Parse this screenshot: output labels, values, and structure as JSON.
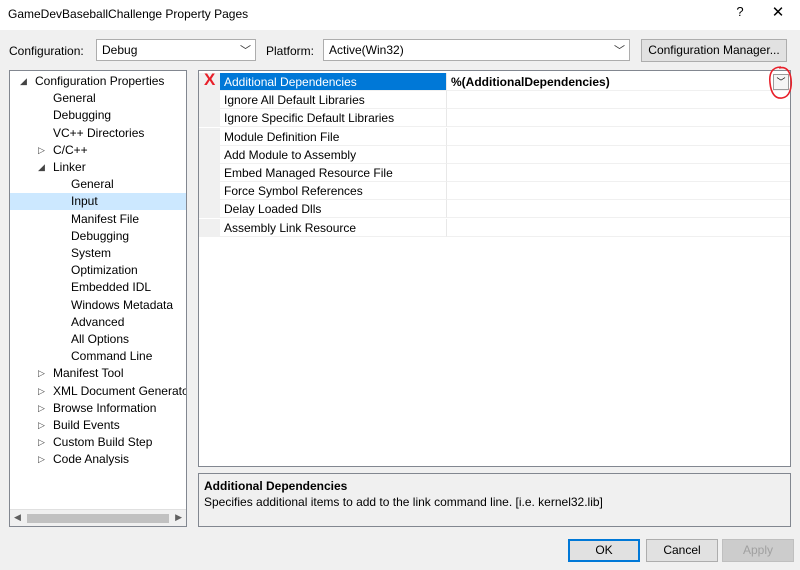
{
  "window": {
    "title": "GameDevBaseballChallenge Property Pages",
    "help": "?",
    "close": "✕"
  },
  "config_row": {
    "configuration_label": "Configuration:",
    "configuration_value": "Debug",
    "platform_label": "Platform:",
    "platform_value": "Active(Win32)",
    "manager_button": "Configuration Manager..."
  },
  "tree": {
    "items": [
      {
        "label": "Configuration Properties",
        "arrow": "◢"
      },
      {
        "label": "General",
        "arrow": ""
      },
      {
        "label": "Debugging",
        "arrow": ""
      },
      {
        "label": "VC++ Directories",
        "arrow": ""
      },
      {
        "label": "C/C++",
        "arrow": "▷"
      },
      {
        "label": "Linker",
        "arrow": "◢"
      },
      {
        "label": "General",
        "arrow": ""
      },
      {
        "label": "Input",
        "arrow": ""
      },
      {
        "label": "Manifest File",
        "arrow": ""
      },
      {
        "label": "Debugging",
        "arrow": ""
      },
      {
        "label": "System",
        "arrow": ""
      },
      {
        "label": "Optimization",
        "arrow": ""
      },
      {
        "label": "Embedded IDL",
        "arrow": ""
      },
      {
        "label": "Windows Metadata",
        "arrow": ""
      },
      {
        "label": "Advanced",
        "arrow": ""
      },
      {
        "label": "All Options",
        "arrow": ""
      },
      {
        "label": "Command Line",
        "arrow": ""
      },
      {
        "label": "Manifest Tool",
        "arrow": "▷"
      },
      {
        "label": "XML Document Generator",
        "arrow": "▷"
      },
      {
        "label": "Browse Information",
        "arrow": "▷"
      },
      {
        "label": "Build Events",
        "arrow": "▷"
      },
      {
        "label": "Custom Build Step",
        "arrow": "▷"
      },
      {
        "label": "Code Analysis",
        "arrow": "▷"
      }
    ],
    "scroll_left": "◀",
    "scroll_right": "▶"
  },
  "grid": {
    "rows": [
      {
        "name": "Additional Dependencies",
        "value": "%(AdditionalDependencies)"
      },
      {
        "name": "Ignore All Default Libraries",
        "value": ""
      },
      {
        "name": "Ignore Specific Default Libraries",
        "value": ""
      },
      {
        "name": "Module Definition File",
        "value": ""
      },
      {
        "name": "Add Module to Assembly",
        "value": ""
      },
      {
        "name": "Embed Managed Resource File",
        "value": ""
      },
      {
        "name": "Force Symbol References",
        "value": ""
      },
      {
        "name": "Delay Loaded Dlls",
        "value": ""
      },
      {
        "name": "Assembly Link Resource",
        "value": ""
      }
    ],
    "annotation_mark": "X"
  },
  "description": {
    "title": "Additional Dependencies",
    "text": "Specifies additional items to add to the link command line. [i.e. kernel32.lib]"
  },
  "buttons": {
    "ok": "OK",
    "cancel": "Cancel",
    "apply": "Apply"
  },
  "colors": {
    "selection": "#0078d7",
    "tree_selection": "#cce8ff",
    "annotation": "#e8202a"
  }
}
